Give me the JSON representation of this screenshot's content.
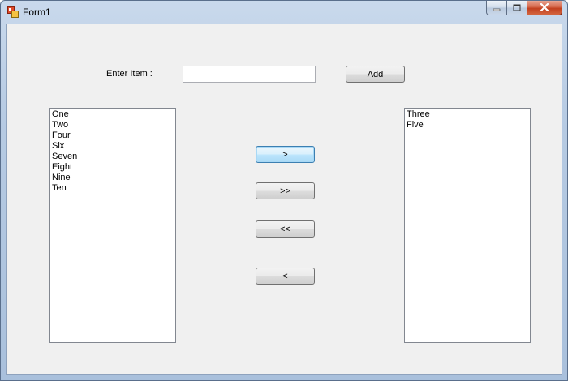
{
  "window": {
    "title": "Form1"
  },
  "form": {
    "enter_item_label": "Enter Item :",
    "item_input_value": "",
    "add_button_label": "Add"
  },
  "transfer_buttons": {
    "move_selected_right": ">",
    "move_all_right": ">>",
    "move_all_left": "<<",
    "move_selected_left": "<"
  },
  "left_list": {
    "items": [
      "One",
      "Two",
      "Four",
      "Six",
      "Seven",
      "Eight",
      "Nine",
      "Ten"
    ]
  },
  "right_list": {
    "items": [
      "Three",
      "Five"
    ]
  },
  "icons": {
    "app": "app-window-icon",
    "minimize": "minimize-icon",
    "maximize": "maximize-icon",
    "close": "close-icon"
  },
  "colors": {
    "client_background": "#f0f0f0",
    "close_button": "#c2401f",
    "focus_border": "#3c7fb1"
  }
}
